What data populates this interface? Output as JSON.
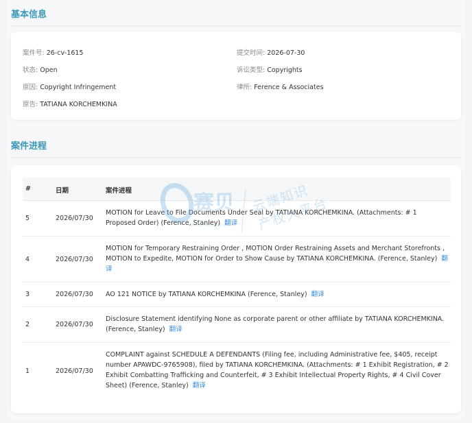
{
  "basic_info": {
    "title": "基本信息",
    "case_no": {
      "label": "案件号:",
      "value": "26-cv-1615"
    },
    "submit_time": {
      "label": "提交时间:",
      "value": "2026-07-30"
    },
    "status": {
      "label": "状态:",
      "value": "Open"
    },
    "litigation_type": {
      "label": "诉讼类型:",
      "value": "Copyrights"
    },
    "cause": {
      "label": "原因:",
      "value": "Copyright Infringement"
    },
    "law_firm": {
      "label": "律所:",
      "value": "Ference & Associates"
    },
    "plaintiff": {
      "label": "原告:",
      "value": "TATIANA KORCHEMKINA"
    }
  },
  "progress": {
    "title": "案件进程",
    "headers": {
      "num": "#",
      "date": "日期",
      "event": "案件进程"
    },
    "translate_label": "翻译",
    "rows": [
      {
        "num": "5",
        "date": "2026/07/30",
        "text": "MOTION for Leave to File Documents Under Seal by TATIANA KORCHEMKINA. (Attachments: # 1 Proposed Order) (Ference, Stanley)"
      },
      {
        "num": "4",
        "date": "2026/07/30",
        "text": "MOTION for Temporary Restraining Order , MOTION Order Restraining Assets and Merchant Storefronts , MOTION to Expedite, MOTION for Order to Show Cause by TATIANA KORCHEMKINA. (Ference, Stanley)"
      },
      {
        "num": "3",
        "date": "2026/07/30",
        "text": "AO 121 NOTICE by TATIANA KORCHEMKINA (Ference, Stanley)"
      },
      {
        "num": "2",
        "date": "2026/07/30",
        "text": "Disclosure Statement identifying None as corporate parent or other affiliate by TATIANA KORCHEMKINA. (Ference, Stanley)"
      },
      {
        "num": "1",
        "date": "2026/07/30",
        "text": "COMPLAINT against SCHEDULE A DEFENDANTS (Filing fee, including Administrative fee, $405, receipt number APAWDC-9765908), filed by TATIANA KORCHEMKINA. (Attachments: # 1 Exhibit Registration, # 2 Exhibit Combatting Trafficking and Counterfeit, # 3 Exhibit Intellectual Property Rights, # 4 Civil Cover Sheet) (Ference, Stanley)"
      }
    ]
  },
  "watermark": {
    "brand": "赛贝",
    "url": "www.saibeiip.com",
    "line1": "云端知识",
    "line2": "产权大平台"
  },
  "colors": {
    "accent": "#3c97b8",
    "link": "#3b8ddb"
  }
}
